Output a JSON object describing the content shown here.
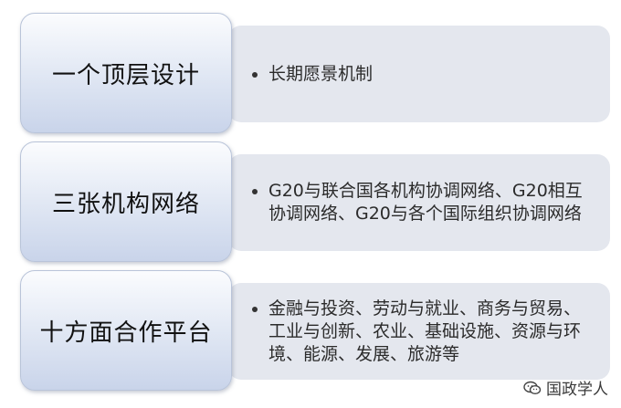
{
  "rows": [
    {
      "label": "一个顶层设计",
      "bullet": "长期愿景机制"
    },
    {
      "label": "三张机构网络",
      "bullet": "G20与联合国各机构协调网络、G20相互协调网络、G20与各个国际组织协调网络"
    },
    {
      "label": "十方面合作平台",
      "bullet": "金融与投资、劳动与就业、商务与贸易、工业与创新、农业、基础设施、资源与环境、能源、发展、旅游等"
    }
  ],
  "watermark": {
    "text": "国政学人",
    "icon": "wechat-icon"
  }
}
